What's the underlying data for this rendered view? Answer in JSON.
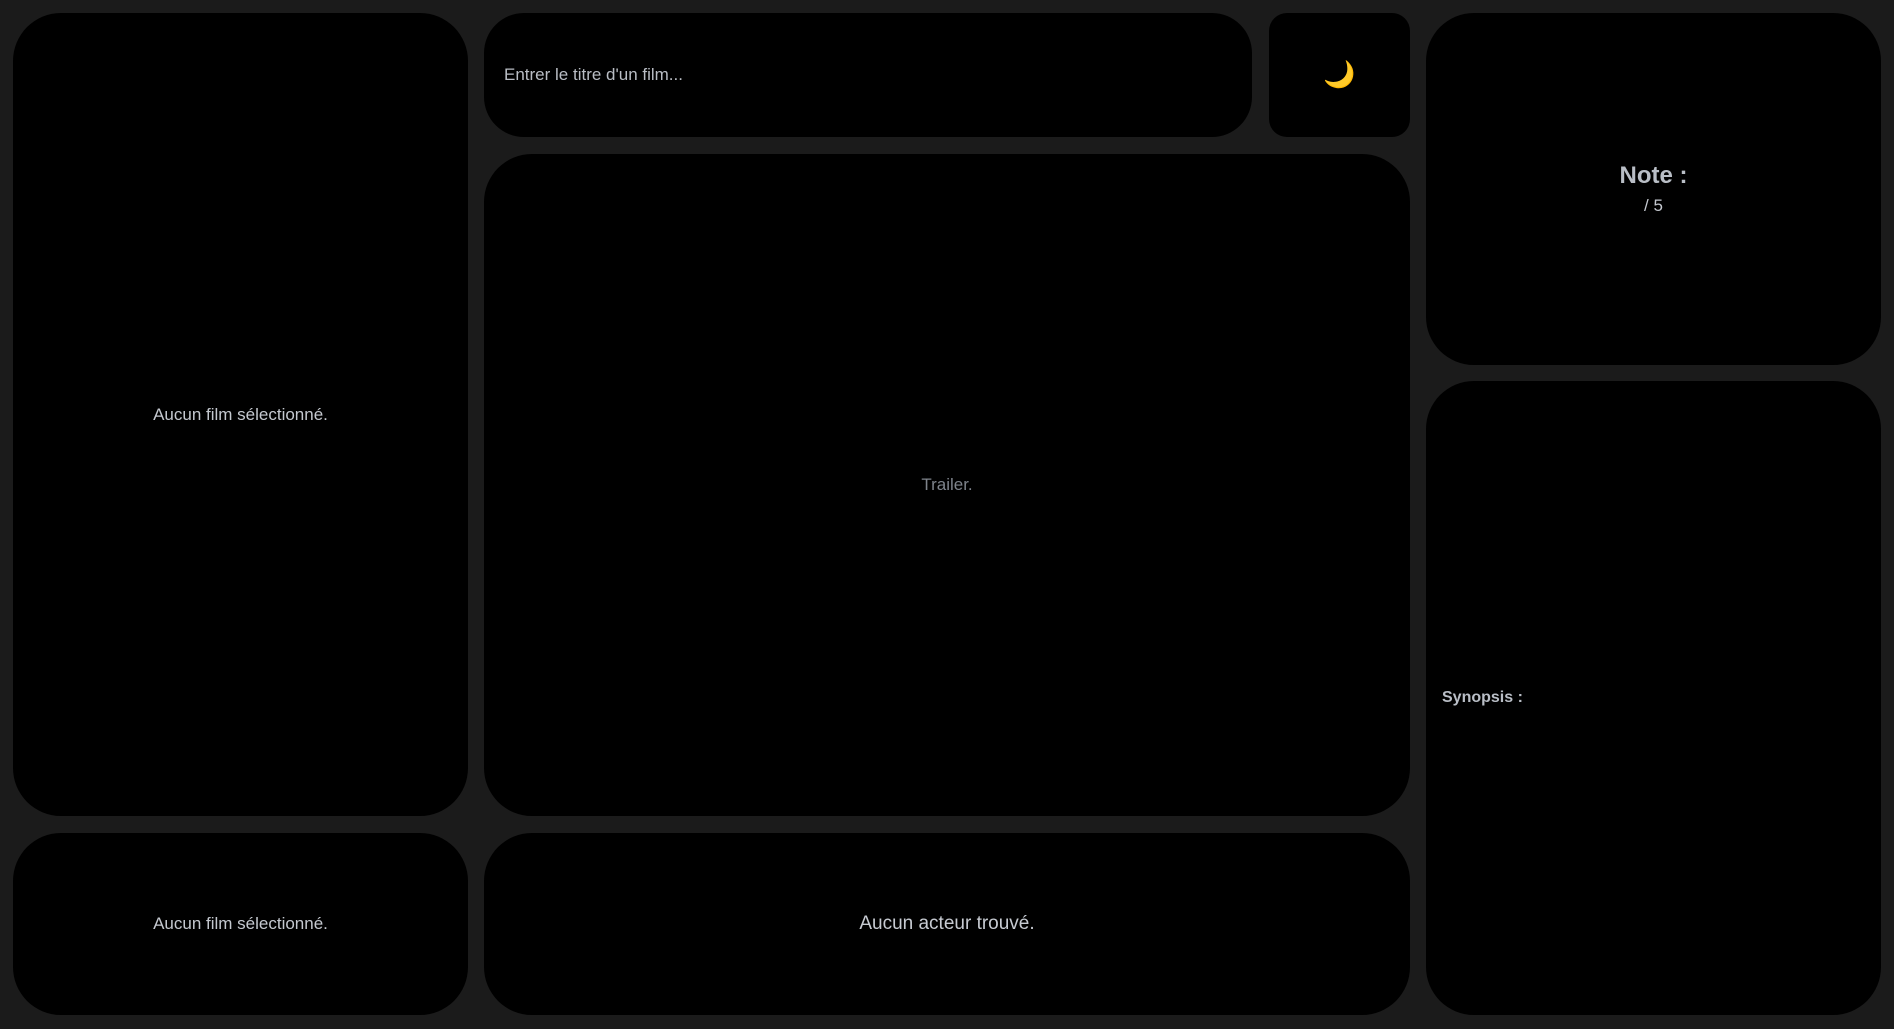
{
  "poster": {
    "empty_text": "Aucun film sélectionné."
  },
  "info": {
    "empty_text": "Aucun film sélectionné."
  },
  "search": {
    "placeholder": "Entrer le titre d'un film...",
    "value": ""
  },
  "theme_toggle": {
    "icon": "moon-icon",
    "glyph": "🌙",
    "icon_color": "#f2c13b"
  },
  "trailer": {
    "text": "Trailer."
  },
  "actors": {
    "empty_text": "Aucun acteur trouvé."
  },
  "rating": {
    "title": "Note :",
    "value": "/ 5"
  },
  "synopsis": {
    "label": "Synopsis :"
  },
  "colors": {
    "background": "#1b1b1b",
    "panel": "#000000"
  }
}
